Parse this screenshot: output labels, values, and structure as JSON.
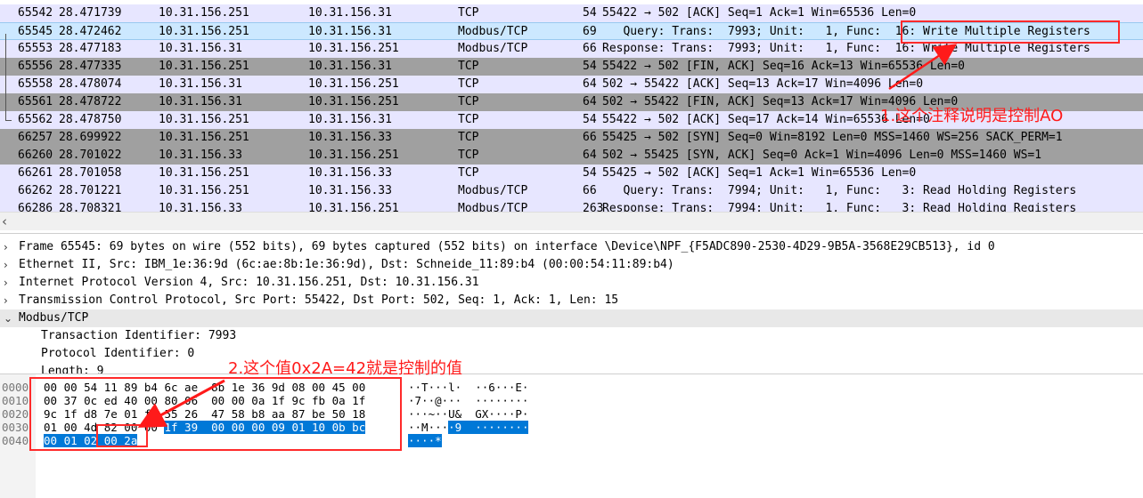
{
  "packet_list": [
    {
      "no": "65542",
      "time": "28.471739",
      "src": "10.31.156.251",
      "dst": "10.31.156.31",
      "proto": "TCP",
      "len": "54",
      "info": "55422 → 502 [ACK] Seq=1 Ack=1 Win=65536 Len=0",
      "style": "light"
    },
    {
      "no": "65545",
      "time": "28.472462",
      "src": "10.31.156.251",
      "dst": "10.31.156.31",
      "proto": "Modbus/TCP",
      "len": "69",
      "info": "   Query: Trans:  7993; Unit:   1, Func:  16: Write Multiple Registers",
      "style": "sel"
    },
    {
      "no": "65553",
      "time": "28.477183",
      "src": "10.31.156.31",
      "dst": "10.31.156.251",
      "proto": "Modbus/TCP",
      "len": "66",
      "info": "Response: Trans:  7993; Unit:   1, Func:  16: Write Multiple Registers",
      "style": "light"
    },
    {
      "no": "65556",
      "time": "28.477335",
      "src": "10.31.156.251",
      "dst": "10.31.156.31",
      "proto": "TCP",
      "len": "54",
      "info": "55422 → 502 [FIN, ACK] Seq=16 Ack=13 Win=65536 Len=0",
      "style": "dark"
    },
    {
      "no": "65558",
      "time": "28.478074",
      "src": "10.31.156.31",
      "dst": "10.31.156.251",
      "proto": "TCP",
      "len": "64",
      "info": "502 → 55422 [ACK] Seq=13 Ack=17 Win=4096 Len=0",
      "style": "light"
    },
    {
      "no": "65561",
      "time": "28.478722",
      "src": "10.31.156.31",
      "dst": "10.31.156.251",
      "proto": "TCP",
      "len": "64",
      "info": "502 → 55422 [FIN, ACK] Seq=13 Ack=17 Win=4096 Len=0",
      "style": "dark"
    },
    {
      "no": "65562",
      "time": "28.478750",
      "src": "10.31.156.251",
      "dst": "10.31.156.31",
      "proto": "TCP",
      "len": "54",
      "info": "55422 → 502 [ACK] Seq=17 Ack=14 Win=65536 Len=0",
      "style": "light"
    },
    {
      "no": "66257",
      "time": "28.699922",
      "src": "10.31.156.251",
      "dst": "10.31.156.33",
      "proto": "TCP",
      "len": "66",
      "info": "55425 → 502 [SYN] Seq=0 Win=8192 Len=0 MSS=1460 WS=256 SACK_PERM=1",
      "style": "dark"
    },
    {
      "no": "66260",
      "time": "28.701022",
      "src": "10.31.156.33",
      "dst": "10.31.156.251",
      "proto": "TCP",
      "len": "64",
      "info": "502 → 55425 [SYN, ACK] Seq=0 Ack=1 Win=4096 Len=0 MSS=1460 WS=1",
      "style": "dark"
    },
    {
      "no": "66261",
      "time": "28.701058",
      "src": "10.31.156.251",
      "dst": "10.31.156.33",
      "proto": "TCP",
      "len": "54",
      "info": "55425 → 502 [ACK] Seq=1 Ack=1 Win=65536 Len=0",
      "style": "light"
    },
    {
      "no": "66262",
      "time": "28.701221",
      "src": "10.31.156.251",
      "dst": "10.31.156.33",
      "proto": "Modbus/TCP",
      "len": "66",
      "info": "   Query: Trans:  7994; Unit:   1, Func:   3: Read Holding Registers",
      "style": "light"
    },
    {
      "no": "66286",
      "time": "28.708321",
      "src": "10.31.156.33",
      "dst": "10.31.156.251",
      "proto": "Modbus/TCP",
      "len": "263",
      "info": "Response: Trans:  7994; Unit:   1, Func:   3: Read Holding Registers",
      "style": "light"
    }
  ],
  "details": [
    {
      "arrow": "›",
      "text": "Frame 65545: 69 bytes on wire (552 bits), 69 bytes captured (552 bits) on interface \\Device\\NPF_{F5ADC890-2530-4D29-9B5A-3568E29CB513}, id 0",
      "indent": 0
    },
    {
      "arrow": "›",
      "text": "Ethernet II, Src: IBM_1e:36:9d (6c:ae:8b:1e:36:9d), Dst: Schneide_11:89:b4 (00:00:54:11:89:b4)",
      "indent": 0
    },
    {
      "arrow": "›",
      "text": "Internet Protocol Version 4, Src: 10.31.156.251, Dst: 10.31.156.31",
      "indent": 0
    },
    {
      "arrow": "›",
      "text": "Transmission Control Protocol, Src Port: 55422, Dst Port: 502, Seq: 1, Ack: 1, Len: 15",
      "indent": 0
    },
    {
      "arrow": "⌄",
      "text": "Modbus/TCP",
      "indent": 0
    },
    {
      "arrow": "",
      "text": "Transaction Identifier: 7993",
      "indent": 1
    },
    {
      "arrow": "",
      "text": "Protocol Identifier: 0",
      "indent": 1
    },
    {
      "arrow": "",
      "text": "Length: 9",
      "indent": 1
    }
  ],
  "hex": [
    {
      "off": "0000",
      "bytes": "00 00 54 11 89 b4 6c ae  8b 1e 36 9d 08 00 45 00",
      "ascii": "··T···l·  ··6···E·",
      "sel_bytes": "",
      "sel_ascii": ""
    },
    {
      "off": "0010",
      "bytes": "00 37 0c ed 40 00 80 06  00 00 0a 1f 9c fb 0a 1f",
      "ascii": "·7··@···  ········",
      "sel_bytes": "",
      "sel_ascii": ""
    },
    {
      "off": "0020",
      "bytes": "9c 1f d8 7e 01 f6 55 26  47 58 b8 aa 87 be 50 18",
      "ascii": "···~··U&  GX····P·",
      "sel_bytes": "",
      "sel_ascii": ""
    },
    {
      "off": "0030",
      "bytes": "01 00 4d 82 00 00 ",
      "ascii": "··M···",
      "sel_bytes": "1f 39  00 00 00 09 01 10 0b bc",
      "sel_ascii": "·9  ········"
    },
    {
      "off": "0040",
      "bytes": "",
      "ascii": "",
      "sel_bytes": "00 01 02 00 2a",
      "sel_ascii": "····*"
    }
  ],
  "annotations": {
    "note1": "1.这个注释说明是控制AO",
    "note2": "2.这个值0x2A=42就是控制的值",
    "color": "#ff1a1a"
  }
}
